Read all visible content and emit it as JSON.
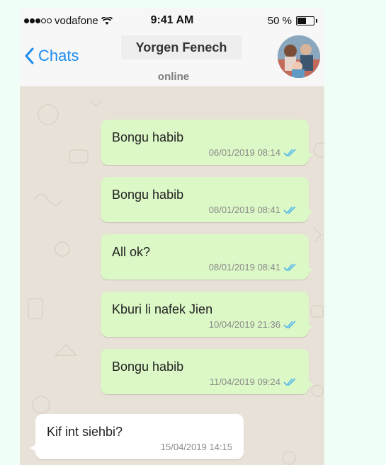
{
  "status_bar": {
    "carrier": "vodafone",
    "time": "9:41 AM",
    "battery_text": "50 %",
    "battery_level": 0.5
  },
  "header": {
    "back_label": "Chats",
    "contact_name": "Yorgen Fenech",
    "presence": "online"
  },
  "messages": [
    {
      "text": "Bongu habib",
      "timestamp": "06/01/2019 08:14",
      "direction": "outgoing",
      "read": true
    },
    {
      "text": "Bongu habib",
      "timestamp": "08/01/2019 08:41",
      "direction": "outgoing",
      "read": true
    },
    {
      "text": "All ok?",
      "timestamp": "08/01/2019 08:41",
      "direction": "outgoing",
      "read": true
    },
    {
      "text": "Kburi li nafek Jien",
      "timestamp": "10/04/2019 21:36",
      "direction": "outgoing",
      "read": true
    },
    {
      "text": "Bongu habib",
      "timestamp": "11/04/2019 09:24",
      "direction": "outgoing",
      "read": true
    },
    {
      "text": "Kif int siehbi?",
      "timestamp": "15/04/2019 14:15",
      "direction": "incoming",
      "read": false
    }
  ],
  "colors": {
    "accent": "#1d8cf0",
    "outgoing_bubble": "#dcf8c6",
    "incoming_bubble": "#ffffff",
    "read_ticks": "#4fb6ec",
    "chat_background": "#e8e1d7"
  },
  "icons": [
    "wifi-icon",
    "battery-icon",
    "back-chevron-icon",
    "double-check-icon",
    "avatar"
  ]
}
